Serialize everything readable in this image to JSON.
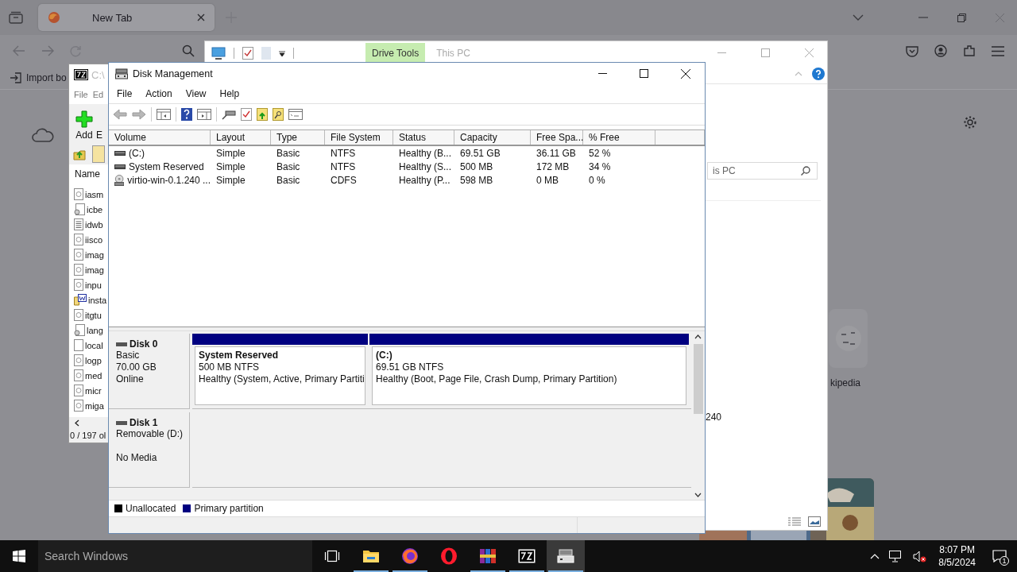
{
  "browser": {
    "tab": {
      "title": "New Tab",
      "selected": true
    },
    "bookmark": "Import bo",
    "tile_label": "kipedia"
  },
  "explorer": {
    "ribbon_tab": "Drive Tools",
    "title": "This PC",
    "search_placeholder": "is PC",
    "item_text": "240"
  },
  "sevenzip": {
    "title": "C:\\",
    "menu": [
      "File",
      "Ed"
    ],
    "toolbar": [
      "Add",
      "E"
    ],
    "column": "Name",
    "files": [
      {
        "name": "iasm",
        "kind": "doc"
      },
      {
        "name": "icbe",
        "kind": "config"
      },
      {
        "name": "idwb",
        "kind": "text"
      },
      {
        "name": "iisco",
        "kind": "doc"
      },
      {
        "name": "imag",
        "kind": "doc"
      },
      {
        "name": "imag",
        "kind": "doc"
      },
      {
        "name": "inpu",
        "kind": "doc"
      },
      {
        "name": "insta",
        "kind": "setup"
      },
      {
        "name": "itgtu",
        "kind": "doc"
      },
      {
        "name": "lang",
        "kind": "config"
      },
      {
        "name": "local",
        "kind": "blank"
      },
      {
        "name": "logp",
        "kind": "doc"
      },
      {
        "name": "med",
        "kind": "doc"
      },
      {
        "name": "micr",
        "kind": "doc"
      },
      {
        "name": "miga",
        "kind": "doc"
      }
    ],
    "status": "0 / 197 ol"
  },
  "disk_management": {
    "title": "Disk Management",
    "menu": [
      "File",
      "Action",
      "View",
      "Help"
    ],
    "toolbar": [
      {
        "kind": "back",
        "disabled": true
      },
      {
        "kind": "forward",
        "disabled": true
      },
      {
        "kind": "console",
        "disabled": false
      },
      {
        "kind": "help",
        "disabled": false
      },
      {
        "kind": "pane",
        "disabled": false
      },
      {
        "kind": "connect",
        "disabled": false
      },
      {
        "kind": "check",
        "disabled": false
      },
      {
        "kind": "folder-up",
        "disabled": false
      },
      {
        "kind": "folder-search",
        "disabled": false
      },
      {
        "kind": "window",
        "disabled": false
      }
    ],
    "columns": [
      "Volume",
      "Layout",
      "Type",
      "File System",
      "Status",
      "Capacity",
      "Free Spa...",
      "% Free"
    ],
    "volumes": [
      {
        "kind": "drive",
        "cells": [
          "(C:)",
          "Simple",
          "Basic",
          "NTFS",
          "Healthy (B...",
          "69.51 GB",
          "36.11 GB",
          "52 %"
        ]
      },
      {
        "kind": "drive",
        "cells": [
          "System Reserved",
          "Simple",
          "Basic",
          "NTFS",
          "Healthy (S...",
          "500 MB",
          "172 MB",
          "34 %"
        ]
      },
      {
        "kind": "cd",
        "cells": [
          "virtio-win-0.1.240 ...",
          "Simple",
          "Basic",
          "CDFS",
          "Healthy (P...",
          "598 MB",
          "0 MB",
          "0 %"
        ]
      }
    ],
    "disks": [
      {
        "name": "Disk 0",
        "type": "Basic",
        "size": "70.00 GB",
        "state": "Online",
        "partitions": [
          {
            "kind": "primary",
            "name": "System Reserved",
            "size": "500 MB NTFS",
            "status": "Healthy (System, Active, Primary Partiti"
          },
          {
            "kind": "primary",
            "name": "(C:)",
            "size": "69.51 GB NTFS",
            "status": "Healthy (Boot, Page File, Crash Dump, Primary Partition)"
          }
        ]
      },
      {
        "name": "Disk 1",
        "type": "Removable (D:)",
        "state": "No Media"
      }
    ],
    "legend": [
      {
        "kind": "unallocated",
        "label": "Unallocated",
        "color": "#000000"
      },
      {
        "kind": "primary",
        "label": "Primary partition",
        "color": "#000080"
      }
    ]
  },
  "taskbar": {
    "search_placeholder": "Search Windows",
    "apps": [
      {
        "kind": "task-view",
        "running": false,
        "selected": false
      },
      {
        "kind": "folder",
        "running": true,
        "selected": false
      },
      {
        "kind": "firefox",
        "running": true,
        "selected": false
      },
      {
        "kind": "opera",
        "running": false,
        "selected": false
      },
      {
        "kind": "winrar",
        "running": true,
        "selected": false
      },
      {
        "kind": "sevenzip",
        "running": true,
        "selected": false
      },
      {
        "kind": "disk",
        "running": true,
        "selected": true
      }
    ],
    "time": "8:07 PM",
    "date": "8/5/2024",
    "notifications": "1"
  }
}
